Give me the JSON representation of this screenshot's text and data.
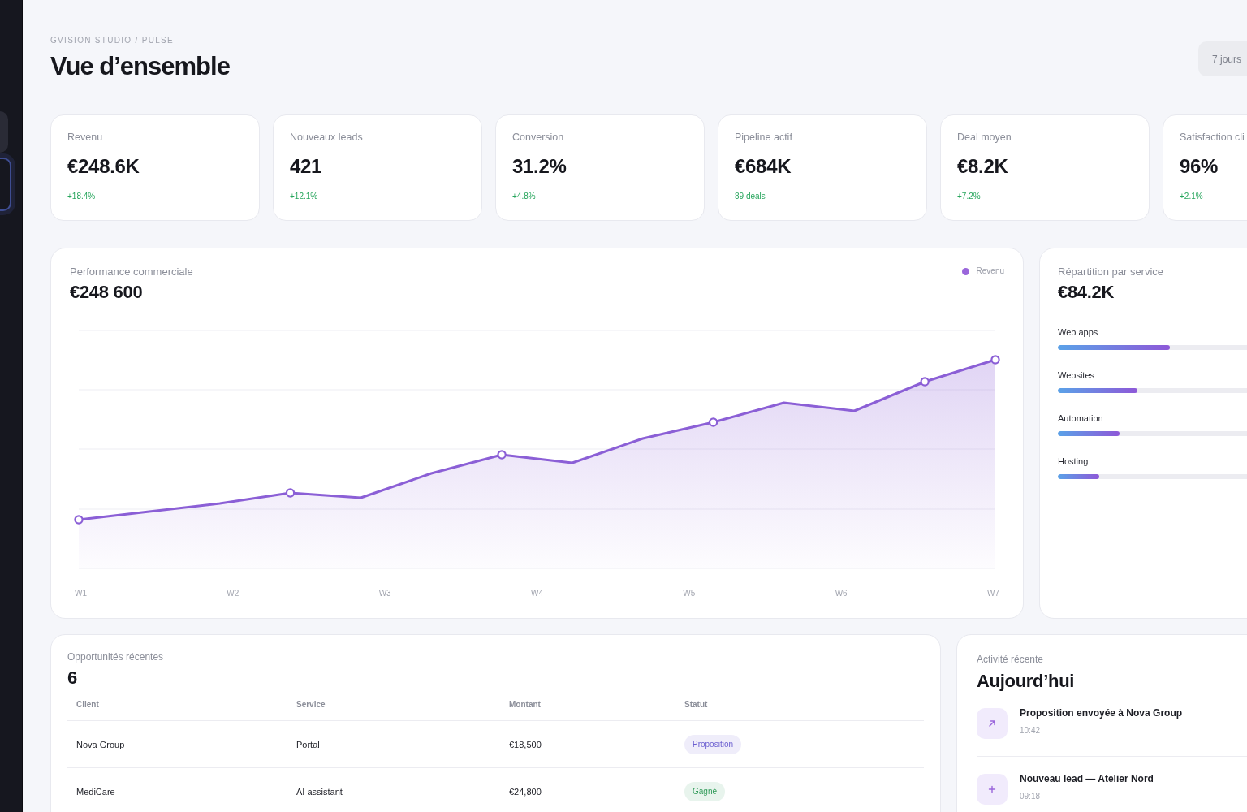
{
  "sidebar": {
    "items": [
      {
        "selected": false
      },
      {
        "selected": true
      }
    ]
  },
  "header": {
    "breadcrumb": "GVISION STUDIO / PULSE",
    "title": "Vue d’ensemble",
    "range_button": "7 jours"
  },
  "kpis": [
    {
      "label": "Revenu",
      "value": "€248.6K",
      "change": "+18.4%"
    },
    {
      "label": "Nouveaux leads",
      "value": "421",
      "change": "+12.1%"
    },
    {
      "label": "Conversion",
      "value": "31.2%",
      "change": "+4.8%"
    },
    {
      "label": "Pipeline actif",
      "value": "€684K",
      "change": "89 deals"
    },
    {
      "label": "Deal moyen",
      "value": "€8.2K",
      "change": "+7.2%"
    },
    {
      "label": "Satisfaction cli",
      "value": "96%",
      "change": "+2.1%"
    }
  ],
  "performance": {
    "label": "Performance commerciale",
    "total": "€248 600",
    "legend": "Revenu",
    "x_labels": [
      "W1",
      "W2",
      "W3",
      "W4",
      "W5",
      "W6",
      "W7"
    ]
  },
  "services": {
    "label": "Répartition par service",
    "total": "€84.2K",
    "items": [
      {
        "label": "Web apps",
        "level": 0.38
      },
      {
        "label": "Websites",
        "level": 0.27
      },
      {
        "label": "Automation",
        "level": 0.21
      },
      {
        "label": "Hosting",
        "level": 0.14
      }
    ]
  },
  "table": {
    "label": "Opportunités récentes",
    "count": "6",
    "columns": [
      "Client",
      "Service",
      "Montant",
      "Statut"
    ],
    "rows": [
      {
        "cells": [
          "Nova Group",
          "Portal",
          "€18,500"
        ],
        "status": {
          "label": "Proposition",
          "color": "#6b5fd0"
        }
      },
      {
        "cells": [
          "MediCare",
          "AI assistant",
          "€24,800"
        ],
        "status": {
          "label": "Gagné",
          "color": "#2f9a58"
        }
      }
    ]
  },
  "activity": {
    "label": "Activité récente",
    "heading": "Aujourd’hui",
    "items": [
      {
        "kind": "sent",
        "title": "Proposition envoyée à Nova Group",
        "time": "10:42"
      },
      {
        "kind": "new",
        "title": "Nouveau lead — Atelier Nord",
        "time": "09:18"
      }
    ]
  }
}
